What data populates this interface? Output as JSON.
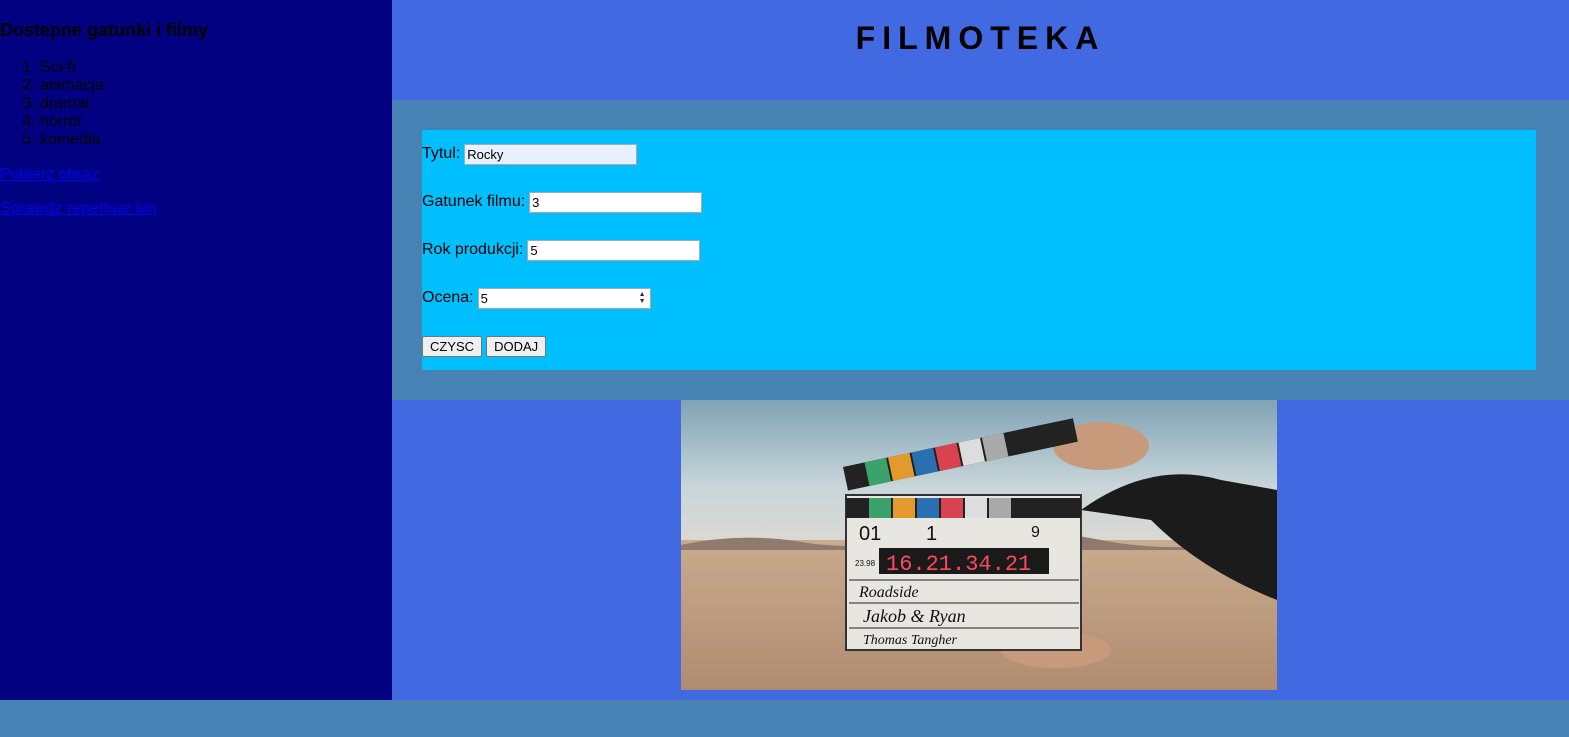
{
  "sidebar": {
    "heading": "Dostepne gatunki i filmy",
    "genres": [
      "Sci-fi",
      "animacja",
      "dramat",
      "horror",
      "komedia"
    ],
    "links": [
      "Pobierz obraz",
      "Sprawdz repertuar kin"
    ]
  },
  "header": {
    "title": "FILMOTEKA"
  },
  "form": {
    "title_label": "Tytul:",
    "title_value": "Rocky",
    "genre_label": "Gatunek filmu:",
    "genre_value": "3",
    "year_label": "Rok produkcji:",
    "year_value": "5",
    "rating_label": "Ocena:",
    "rating_value": "5",
    "clear_label": "CZYSC",
    "add_label": "DODAJ"
  },
  "photo": {
    "clapper_number": "16.21.34.21",
    "roll": "01",
    "scene": "1",
    "take": "9",
    "fps": "23.98",
    "production": "Roadside",
    "director": "Jakob & Ryan",
    "camera": "Thomas Tangher"
  },
  "colors": {
    "sidebar_bg": "#000080",
    "header_bg": "#4169e1",
    "main_bg": "#4682b4",
    "form_bg": "#00bfff",
    "link": "#0000ee"
  }
}
